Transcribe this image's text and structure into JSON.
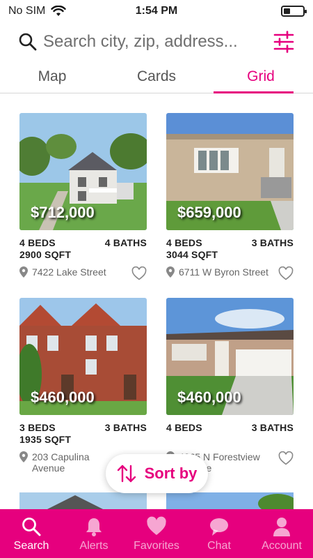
{
  "status_bar": {
    "carrier": "No SIM",
    "time": "1:54 PM",
    "battery_level": 0.35
  },
  "search": {
    "placeholder": "Search city, zip, address..."
  },
  "tabs": [
    {
      "label": "Map",
      "active": false
    },
    {
      "label": "Cards",
      "active": false
    },
    {
      "label": "Grid",
      "active": true
    }
  ],
  "listings": [
    {
      "price": "$712,000",
      "beds": "4 BEDS",
      "baths": "4 BATHS",
      "sqft": "2900 SQFT",
      "address": "7422 Lake Street"
    },
    {
      "price": "$659,000",
      "beds": "4 BEDS",
      "baths": "3 BATHS",
      "sqft": "3044 SQFT",
      "address": "6711 W Byron Street"
    },
    {
      "price": "$460,000",
      "beds": "3 BEDS",
      "baths": "3 BATHS",
      "sqft": "1935 SQFT",
      "address": "203 Capulina Avenue"
    },
    {
      "price": "$460,000",
      "beds": "4 BEDS",
      "baths": "3 BATHS",
      "sqft": "",
      "address": "4365 N Forestview Avenue"
    }
  ],
  "sort": {
    "label": "Sort by"
  },
  "bottom_nav": [
    {
      "label": "Search",
      "icon": "search-icon",
      "active": true
    },
    {
      "label": "Alerts",
      "icon": "bell-icon",
      "active": false
    },
    {
      "label": "Favorites",
      "icon": "heart-icon",
      "active": false
    },
    {
      "label": "Chat",
      "icon": "chat-icon",
      "active": false
    },
    {
      "label": "Account",
      "icon": "person-icon",
      "active": false
    }
  ],
  "colors": {
    "accent": "#e6007e",
    "text": "#1f1f1f",
    "muted": "#666666"
  }
}
